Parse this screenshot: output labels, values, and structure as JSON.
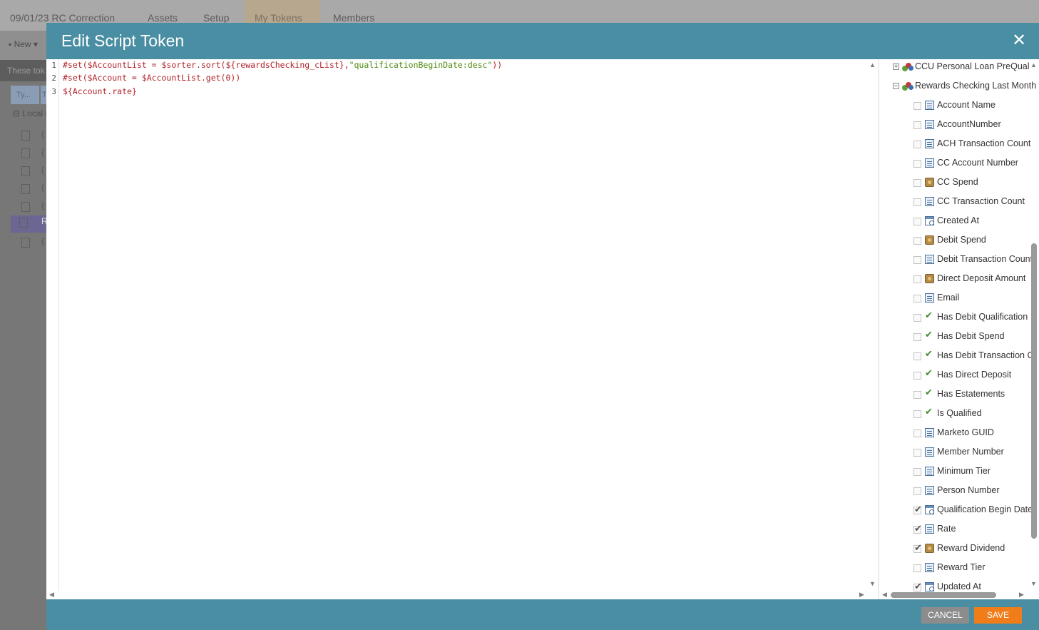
{
  "background": {
    "tabs": [
      {
        "label": "09/01/23 RC Correction"
      },
      {
        "label": "Assets"
      },
      {
        "label": "Setup"
      },
      {
        "label": "My Tokens"
      },
      {
        "label": "Members"
      }
    ],
    "new_label": "New",
    "description": "These tok",
    "col1": "Ty...",
    "col2": "T",
    "local_label": "Local (",
    "selected_row_text": "R"
  },
  "modal": {
    "title": "Edit Script Token",
    "close_symbol": "✕",
    "editor": {
      "line_numbers": [
        "1",
        "2",
        "3"
      ],
      "lines": [
        {
          "directive": "#set(",
          "code": "$AccountList = $sorter.sort(${rewardsChecking_cList},",
          "string": "\"qualificationBeginDate:desc\"",
          "tail": "))"
        },
        {
          "directive": "#set(",
          "code": "$Account = $AccountList.get(0))",
          "string": "",
          "tail": ""
        },
        {
          "directive": "",
          "code": "${Account.rate}",
          "string": "",
          "tail": ""
        }
      ]
    },
    "tree": {
      "objects": [
        {
          "expander": "+",
          "label": "CCU Personal Loan PreQual"
        },
        {
          "expander": "−",
          "label": "Rewards Checking Last Month"
        }
      ],
      "fields": [
        {
          "label": "Account Name",
          "type": "text",
          "checked": false
        },
        {
          "label": "AccountNumber",
          "type": "text",
          "checked": false
        },
        {
          "label": "ACH Transaction Count",
          "type": "text",
          "checked": false
        },
        {
          "label": "CC Account Number",
          "type": "text",
          "checked": false
        },
        {
          "label": "CC Spend",
          "type": "money",
          "checked": false
        },
        {
          "label": "CC Transaction Count",
          "type": "text",
          "checked": false
        },
        {
          "label": "Created At",
          "type": "date",
          "checked": false
        },
        {
          "label": "Debit Spend",
          "type": "money",
          "checked": false
        },
        {
          "label": "Debit Transaction Count",
          "type": "text",
          "checked": false
        },
        {
          "label": "Direct Deposit Amount",
          "type": "money",
          "checked": false
        },
        {
          "label": "Email",
          "type": "text",
          "checked": false
        },
        {
          "label": "Has Debit Qualification",
          "type": "bool",
          "checked": false
        },
        {
          "label": "Has Debit Spend",
          "type": "bool",
          "checked": false
        },
        {
          "label": "Has Debit Transaction C",
          "type": "bool",
          "checked": false
        },
        {
          "label": "Has Direct Deposit",
          "type": "bool",
          "checked": false
        },
        {
          "label": "Has Estatements",
          "type": "bool",
          "checked": false
        },
        {
          "label": "Is Qualified",
          "type": "bool",
          "checked": false
        },
        {
          "label": "Marketo GUID",
          "type": "text",
          "checked": false
        },
        {
          "label": "Member Number",
          "type": "text",
          "checked": false
        },
        {
          "label": "Minimum Tier",
          "type": "text",
          "checked": false
        },
        {
          "label": "Person Number",
          "type": "text",
          "checked": false
        },
        {
          "label": "Qualification Begin Date",
          "type": "date",
          "checked": true
        },
        {
          "label": "Rate",
          "type": "text",
          "checked": true
        },
        {
          "label": "Reward Dividend",
          "type": "money",
          "checked": true
        },
        {
          "label": "Reward Tier",
          "type": "text",
          "checked": false
        },
        {
          "label": "Updated At",
          "type": "date",
          "checked": true
        }
      ]
    },
    "footer": {
      "cancel_label": "CANCEL",
      "save_label": "SAVE"
    }
  },
  "colors": {
    "header": "#4a8ea3",
    "save": "#f07d1a",
    "cancel": "#8c8c8c"
  }
}
